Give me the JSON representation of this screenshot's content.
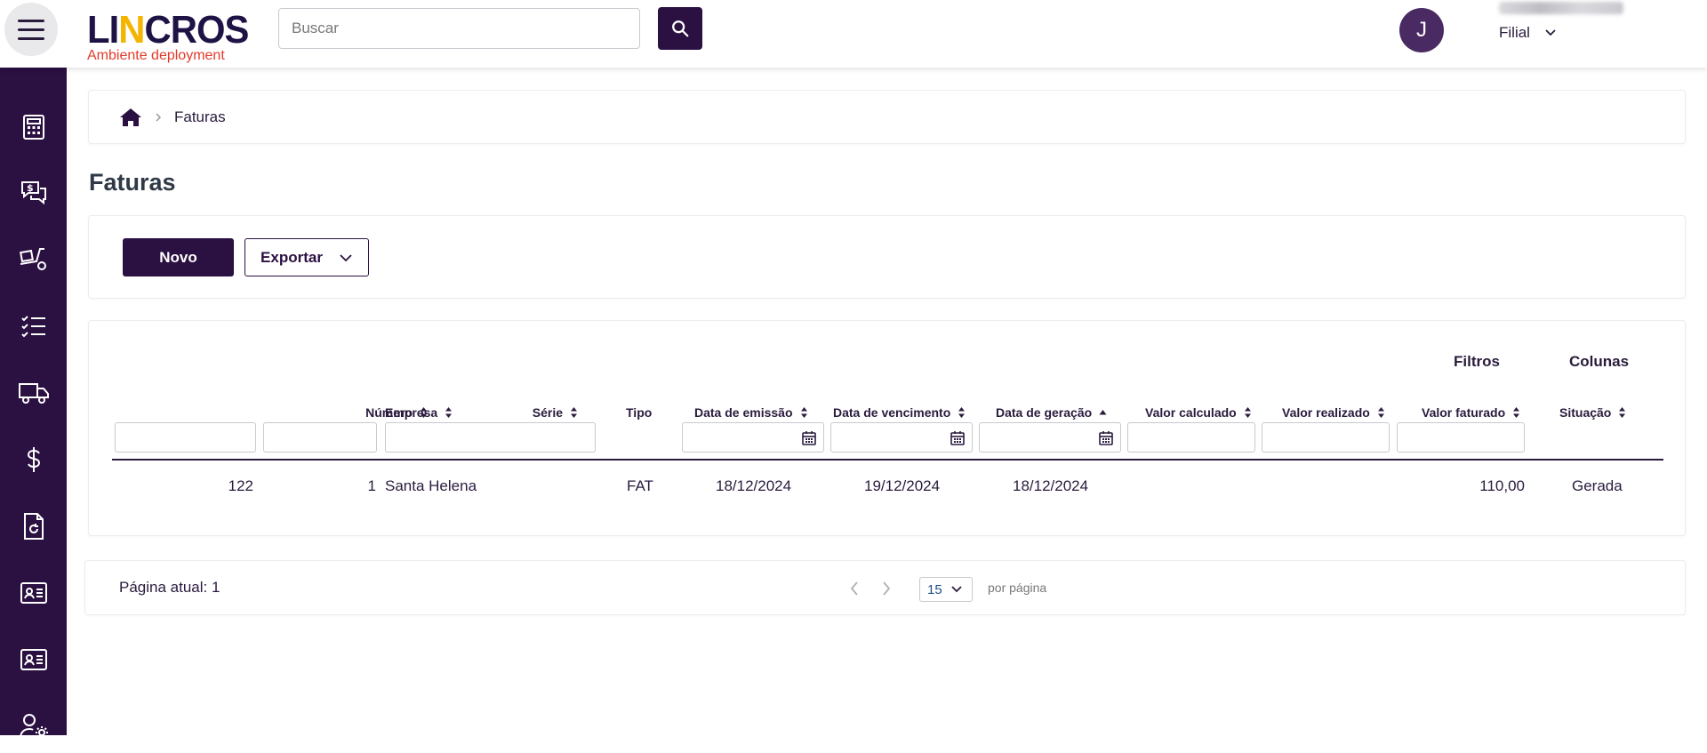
{
  "header": {
    "logo_text_part1": "LI",
    "logo_text_accent": "N",
    "logo_text_part2": "CROS",
    "logo_subtitle": "Ambiente deployment",
    "search_placeholder": "Buscar",
    "avatar_initial": "J",
    "filial_label": "Filial"
  },
  "sidebar": {
    "items": [
      {
        "icon": "calculator-icon"
      },
      {
        "icon": "money-chat-icon"
      },
      {
        "icon": "forklift-icon"
      },
      {
        "icon": "checklist-icon"
      },
      {
        "icon": "truck-icon"
      },
      {
        "icon": "dollar-icon"
      },
      {
        "icon": "document-refresh-icon"
      },
      {
        "icon": "id-card-icon"
      },
      {
        "icon": "id-card-icon"
      },
      {
        "icon": "user-settings-icon"
      }
    ]
  },
  "breadcrumb": {
    "current": "Faturas"
  },
  "page": {
    "title": "Faturas"
  },
  "toolbar": {
    "new_label": "Novo",
    "export_label": "Exportar"
  },
  "table": {
    "filters_link": "Filtros",
    "columns_link": "Colunas",
    "headers": {
      "numero": "Número",
      "serie": "Série",
      "empresa": "Empresa",
      "tipo": "Tipo",
      "data_emissao": "Data de emissão",
      "data_vencimento": "Data de vencimento",
      "data_geracao": "Data de geração",
      "valor_calculado": "Valor calculado",
      "valor_realizado": "Valor realizado",
      "valor_faturado": "Valor faturado",
      "situacao": "Situação"
    },
    "rows": [
      {
        "numero": "122",
        "serie": "1",
        "empresa": "Santa Helena",
        "tipo": "FAT",
        "data_emissao": "18/12/2024",
        "data_vencimento": "19/12/2024",
        "data_geracao": "18/12/2024",
        "valor_calculado": "",
        "valor_realizado": "",
        "valor_faturado": "110,00",
        "situacao": "Gerada"
      }
    ]
  },
  "pagination": {
    "current_page_text": "Página atual: 1",
    "per_page_value": "15",
    "per_page_label": "por página"
  },
  "colors": {
    "primary": "#2b1042",
    "logo_accent": "#f4b400",
    "subtitle": "#e23b2a"
  }
}
